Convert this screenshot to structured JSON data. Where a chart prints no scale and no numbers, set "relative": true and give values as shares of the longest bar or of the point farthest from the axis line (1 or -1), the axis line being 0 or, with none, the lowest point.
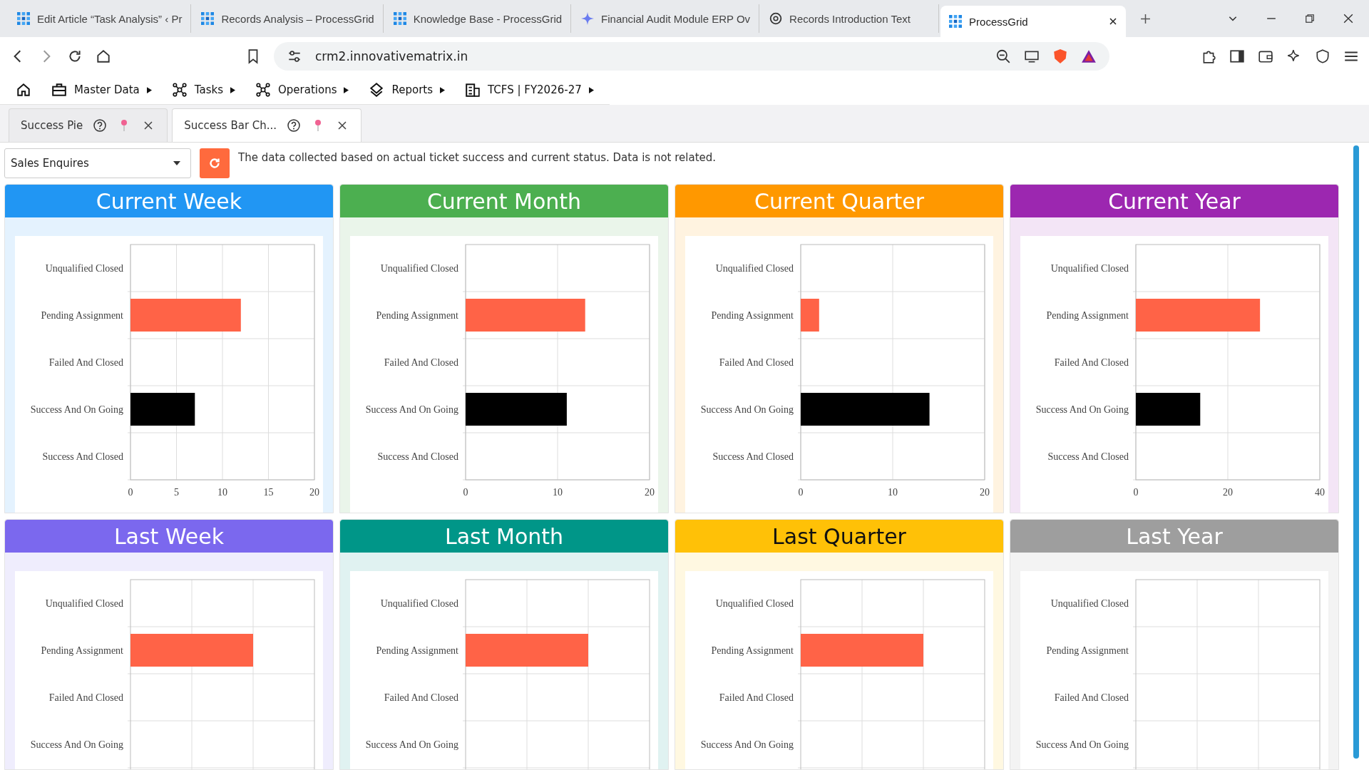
{
  "browser": {
    "tabs": [
      {
        "title": "Edit Article “Task Analysis” ‹ Pr",
        "selected": false
      },
      {
        "title": "Records Analysis – ProcessGrid",
        "selected": false
      },
      {
        "title": "Knowledge Base - ProcessGrid",
        "selected": false
      },
      {
        "title": "Financial Audit Module ERP Ov",
        "selected": false
      },
      {
        "title": "Records Introduction Text",
        "selected": false
      },
      {
        "title": "ProcessGrid",
        "selected": true
      }
    ],
    "url": "crm2.innovativematrix.in"
  },
  "menu": [
    {
      "label": "Master Data"
    },
    {
      "label": "Tasks"
    },
    {
      "label": "Operations"
    },
    {
      "label": "Reports"
    },
    {
      "label": "TCFS | FY2026-27"
    }
  ],
  "page_tabs": [
    {
      "label": "Success Pie",
      "selected": false
    },
    {
      "label": "Success Bar Ch...",
      "selected": true
    }
  ],
  "filter": {
    "value": "Sales Enquires"
  },
  "note": "The data collected based on actual ticket success and current status. Data is not related.",
  "cards": [
    {
      "title": "Current Week",
      "color": "#2196f3",
      "chart_data": {
        "type": "bar",
        "orientation": "horizontal",
        "stacked": true,
        "grid": true,
        "categories": [
          "Unqualified Closed",
          "Pending Assignment",
          "Failed And Closed",
          "Success And On Going",
          "Success And Closed"
        ],
        "series": [
          {
            "color": "#ff6347",
            "values": [
              0,
              12,
              0,
              0,
              0
            ]
          },
          {
            "color": "#000000",
            "values": [
              0,
              0,
              0,
              7,
              0
            ]
          }
        ],
        "xlim": [
          0,
          20
        ],
        "xticks": [
          0,
          5,
          10,
          15,
          20
        ]
      }
    },
    {
      "title": "Current Month",
      "color": "#4caf50",
      "chart_data": {
        "type": "bar",
        "orientation": "horizontal",
        "stacked": true,
        "grid": true,
        "categories": [
          "Unqualified Closed",
          "Pending Assignment",
          "Failed And Closed",
          "Success And On Going",
          "Success And Closed"
        ],
        "series": [
          {
            "color": "#ff6347",
            "values": [
              0,
              13,
              0,
              0,
              0
            ]
          },
          {
            "color": "#000000",
            "values": [
              0,
              0,
              0,
              11,
              0
            ]
          }
        ],
        "xlim": [
          0,
          20
        ],
        "xticks": [
          0,
          10,
          20
        ]
      }
    },
    {
      "title": "Current Quarter",
      "color": "#ff9800",
      "chart_data": {
        "type": "bar",
        "orientation": "horizontal",
        "stacked": true,
        "grid": true,
        "categories": [
          "Unqualified Closed",
          "Pending Assignment",
          "Failed And Closed",
          "Success And On Going",
          "Success And Closed"
        ],
        "series": [
          {
            "color": "#ff6347",
            "values": [
              0,
              2,
              0,
              0,
              0
            ]
          },
          {
            "color": "#000000",
            "values": [
              0,
              0,
              0,
              14,
              0
            ]
          }
        ],
        "xlim": [
          0,
          20
        ],
        "xticks": [
          0,
          10,
          20
        ]
      }
    },
    {
      "title": "Current Year",
      "color": "#9c27b0",
      "chart_data": {
        "type": "bar",
        "orientation": "horizontal",
        "stacked": true,
        "grid": true,
        "categories": [
          "Unqualified Closed",
          "Pending Assignment",
          "Failed And Closed",
          "Success And On Going",
          "Success And Closed"
        ],
        "series": [
          {
            "color": "#ff6347",
            "values": [
              0,
              27,
              0,
              0,
              0
            ]
          },
          {
            "color": "#000000",
            "values": [
              0,
              0,
              0,
              14,
              0
            ]
          }
        ],
        "xlim": [
          0,
          40
        ],
        "xticks": [
          0,
          20,
          40
        ]
      }
    },
    {
      "title": "Last Week",
      "color": "#7b68ee",
      "chart_data": {
        "type": "bar",
        "orientation": "horizontal",
        "relative": true,
        "grid": true,
        "categories": [
          "Unqualified Closed",
          "Pending Assignment",
          "Failed And Closed",
          "Success And On Going"
        ],
        "values": [
          0,
          1,
          0,
          0
        ]
      }
    },
    {
      "title": "Last Month",
      "color": "#009688",
      "chart_data": {
        "type": "bar",
        "orientation": "horizontal",
        "relative": true,
        "grid": true,
        "categories": [
          "Unqualified Closed",
          "Pending Assignment",
          "Failed And Closed",
          "Success And On Going"
        ],
        "values": [
          0,
          1,
          0,
          0
        ]
      }
    },
    {
      "title": "Last Quarter",
      "color": "#ffc107",
      "chart_data": {
        "type": "bar",
        "orientation": "horizontal",
        "relative": true,
        "grid": true,
        "categories": [
          "Unqualified Closed",
          "Pending Assignment",
          "Failed And Closed",
          "Success And On Going"
        ],
        "values": [
          0,
          1,
          0,
          0
        ]
      }
    },
    {
      "title": "Last Year",
      "color": "#9e9e9e",
      "chart_data": {
        "type": "other",
        "categories": [
          "Unqualified Closed",
          "Pending Assignment",
          "Failed And Closed",
          "Success And On Going"
        ]
      }
    }
  ]
}
